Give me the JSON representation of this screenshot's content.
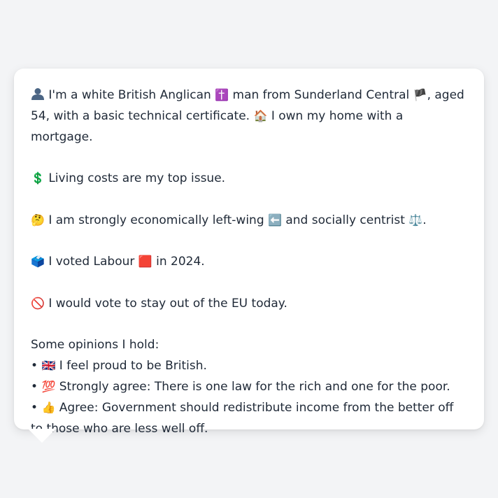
{
  "message": {
    "intro": {
      "icon": "person-silhouette-icon",
      "text_a": "I'm a white British Anglican",
      "cross_glyph": "✝️",
      "text_b": "man from Sunderland Central",
      "flag_glyph": "🏴",
      "text_c": ", aged 54, with a basic technical certificate.",
      "house_glyph": "🏠",
      "text_d": "I own my home with a mortgage."
    },
    "issue": {
      "glyph": "💲",
      "text": "Living costs are my top issue."
    },
    "ideology": {
      "glyph": "🤔",
      "text_a": "I am strongly economically left-wing",
      "left_glyph": "⬅️",
      "text_b": "and socially centrist",
      "scale_glyph": "⚖️",
      "text_c": "."
    },
    "vote": {
      "glyph": "🗳️",
      "text_a": "I voted Labour",
      "party_glyph": "🟥",
      "text_b": "in 2024."
    },
    "eu": {
      "glyph": "🚫",
      "text": "I would vote to stay out of the EU today."
    },
    "opinions": {
      "heading": "Some opinions I hold:",
      "items": [
        {
          "bullet": "•",
          "glyph": "🇬🇧",
          "text": "I feel proud to be British."
        },
        {
          "bullet": "•",
          "glyph": "💯",
          "text": "Strongly agree: There is one law for the rich and one for the poor."
        },
        {
          "bullet": "•",
          "glyph": "👍",
          "text": "Agree: Government should redistribute income from the better off to those who are less well off."
        }
      ]
    }
  }
}
